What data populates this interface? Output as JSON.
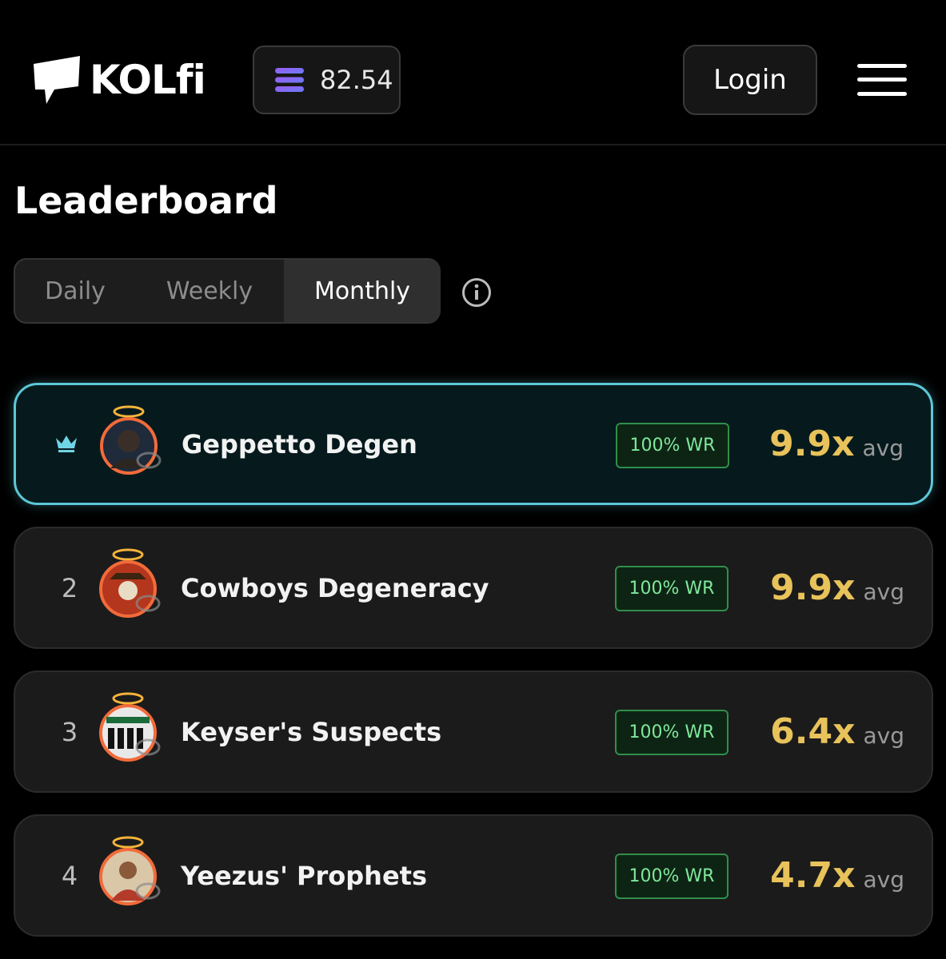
{
  "header": {
    "logo_text": "KOLfi",
    "sol_price": "82.54",
    "login_label": "Login",
    "menu_icon": "hamburger-menu-icon",
    "price_icon": "solana-icon"
  },
  "page": {
    "title": "Leaderboard"
  },
  "tabs": [
    {
      "label": "Daily",
      "active": false
    },
    {
      "label": "Weekly",
      "active": false
    },
    {
      "label": "Monthly",
      "active": true
    }
  ],
  "info_icon": "info-icon",
  "leaderboard": [
    {
      "rank": "",
      "rank_icon": "crown-icon",
      "name": "Geppetto Degen",
      "win_rate": "100% WR",
      "multiplier": "9.9x",
      "unit": "avg",
      "highlight": true
    },
    {
      "rank": "2",
      "name": "Cowboys Degeneracy",
      "win_rate": "100% WR",
      "multiplier": "9.9x",
      "unit": "avg",
      "highlight": false
    },
    {
      "rank": "3",
      "name": "Keyser's Suspects",
      "win_rate": "100% WR",
      "multiplier": "6.4x",
      "unit": "avg",
      "highlight": false
    },
    {
      "rank": "4",
      "name": "Yeezus' Prophets",
      "win_rate": "100% WR",
      "multiplier": "4.7x",
      "unit": "avg",
      "highlight": false
    }
  ],
  "colors": {
    "accent_cyan": "#5cc7d6",
    "multiplier_gold": "#e8c25a",
    "win_rate_green": "#7fe89a",
    "avatar_ring": "#f26b3a"
  }
}
